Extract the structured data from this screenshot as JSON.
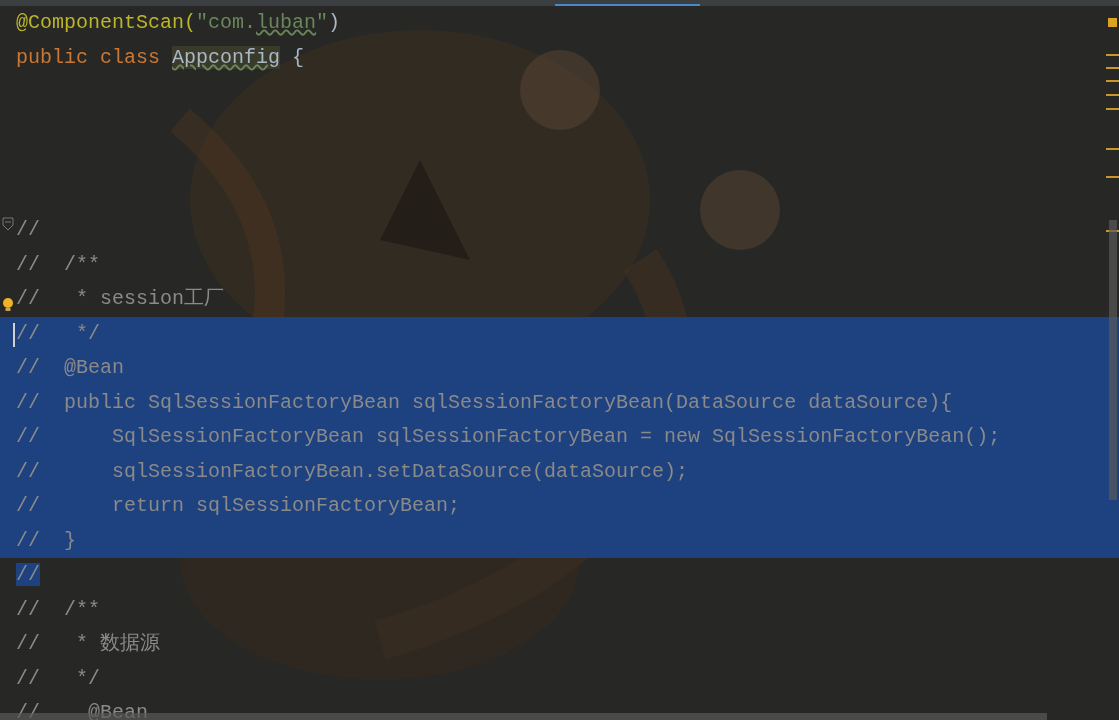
{
  "editor": {
    "lines": [
      {
        "selected": false,
        "tokens": [
          {
            "text": "@ComponentScan(",
            "kind": "annotation"
          },
          {
            "text": "\"com.",
            "kind": "string"
          },
          {
            "text": "luban",
            "kind": "string_typo"
          },
          {
            "text": "\"",
            "kind": "string"
          },
          {
            "text": ")",
            "kind": "plain"
          }
        ]
      },
      {
        "selected": false,
        "tokens": [
          {
            "text": "public class ",
            "kind": "keyword"
          },
          {
            "text": "Appconfig",
            "kind": "class_typo"
          },
          {
            "text": " {",
            "kind": "plain"
          }
        ]
      },
      {
        "selected": false
      },
      {
        "selected": false
      },
      {
        "selected": false
      },
      {
        "selected": false
      },
      {
        "selected": false,
        "tokens": [
          {
            "text": "//",
            "kind": "comment"
          }
        ]
      },
      {
        "selected": false,
        "tokens": [
          {
            "text": "//  /**",
            "kind": "comment"
          }
        ]
      },
      {
        "selected": false,
        "tokens": [
          {
            "text": "//   * session工厂",
            "kind": "comment"
          }
        ]
      },
      {
        "selected": true,
        "tokens": [
          {
            "text": "//   */",
            "kind": "comment"
          }
        ]
      },
      {
        "selected": true,
        "tokens": [
          {
            "text": "//  @Bean",
            "kind": "comment"
          }
        ]
      },
      {
        "selected": true,
        "tokens": [
          {
            "text": "//  public SqlSessionFactoryBean sqlSessionFactoryBean(DataSource dataSource){",
            "kind": "comment"
          }
        ]
      },
      {
        "selected": true,
        "tokens": [
          {
            "text": "//      SqlSessionFactoryBean sqlSessionFactoryBean = new SqlSessionFactoryBean();",
            "kind": "comment"
          }
        ]
      },
      {
        "selected": true,
        "tokens": [
          {
            "text": "//      sqlSessionFactoryBean.setDataSource(dataSource);",
            "kind": "comment"
          }
        ]
      },
      {
        "selected": true,
        "tokens": [
          {
            "text": "//      return sqlSessionFactoryBean;",
            "kind": "comment"
          }
        ]
      },
      {
        "selected": true,
        "tokens": [
          {
            "text": "//  }",
            "kind": "comment"
          }
        ]
      },
      {
        "selected": false,
        "tokens": [
          {
            "text": "//",
            "kind": "comment_selected"
          }
        ]
      },
      {
        "selected": false,
        "tokens": [
          {
            "text": "//  /**",
            "kind": "comment"
          }
        ]
      },
      {
        "selected": false,
        "tokens": [
          {
            "text": "//   * 数据源",
            "kind": "comment"
          }
        ]
      },
      {
        "selected": false,
        "tokens": [
          {
            "text": "//   */",
            "kind": "comment"
          }
        ]
      },
      {
        "selected": false,
        "tokens": [
          {
            "text": "//    @Bean",
            "kind": "comment"
          }
        ]
      }
    ]
  }
}
